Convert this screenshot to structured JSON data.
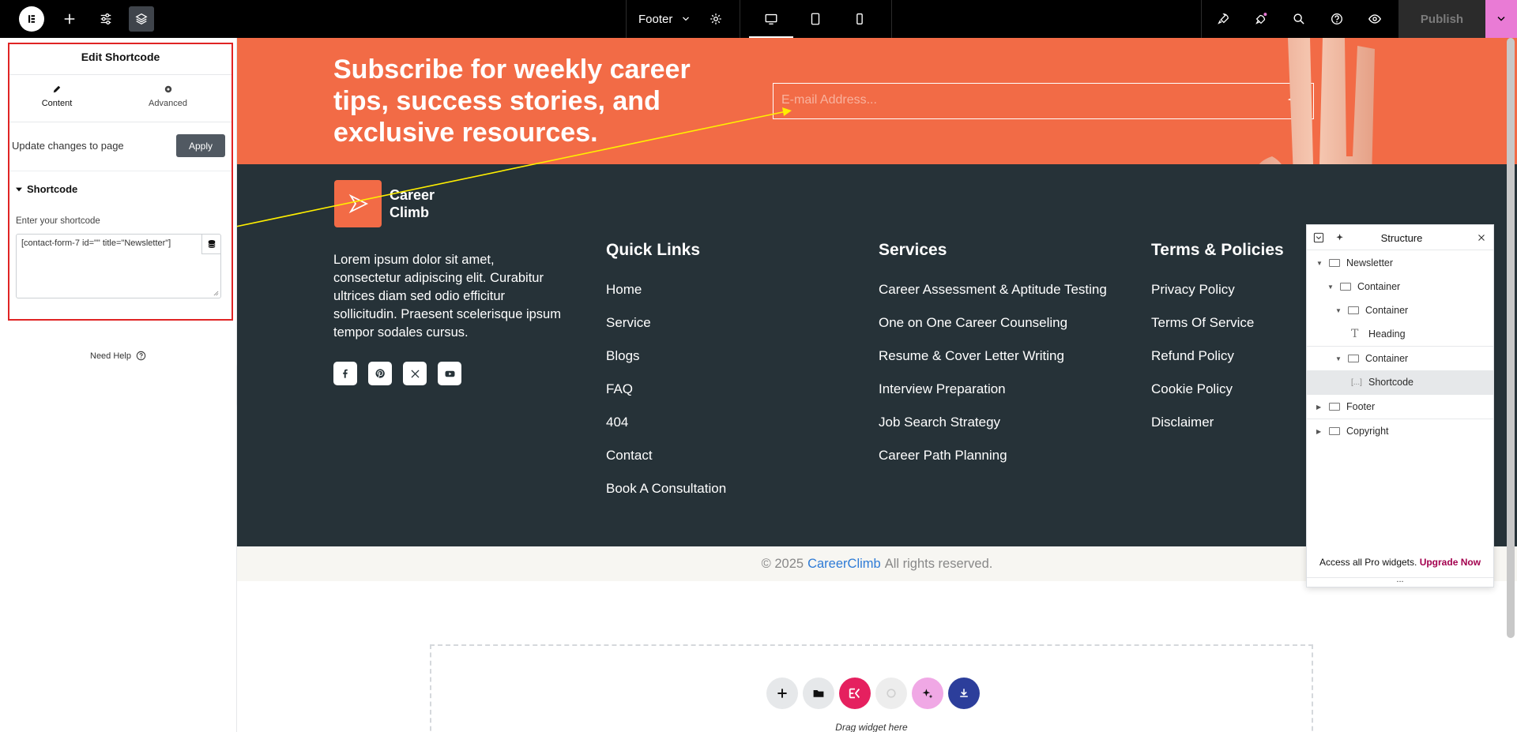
{
  "topbar": {
    "document_name": "Footer",
    "publish_label": "Publish",
    "icons": [
      "elementor-logo-icon",
      "add-icon",
      "sliders-icon",
      "layers-icon",
      "chevron-down-icon",
      "gear-icon",
      "desktop-icon",
      "tablet-icon",
      "mobile-icon",
      "rocket-icon",
      "sparkle-icon",
      "search-icon",
      "help-icon",
      "eye-icon"
    ]
  },
  "panel": {
    "title": "Edit Shortcode",
    "tabs": [
      {
        "label": "Content",
        "icon": "pencil-icon"
      },
      {
        "label": "Advanced",
        "icon": "gear-icon"
      }
    ],
    "update_text": "Update changes to page",
    "apply_label": "Apply",
    "section_title": "Shortcode",
    "field_label": "Enter your shortcode",
    "shortcode_value": "[contact-form-7 id=\"\" title=\"Newsletter\"]",
    "need_help": "Need Help"
  },
  "newsletter": {
    "heading_lines": [
      "Subscribe for weekly career",
      "tips, success stories, and",
      "exclusive resources."
    ],
    "email_placeholder": "E-mail Address...",
    "accent_color": "#f26b46"
  },
  "footer": {
    "brand_line1": "Career",
    "brand_line2": "Climb",
    "description_lines": [
      "Lorem ipsum dolor sit amet,",
      "consectetur adipiscing elit. Curabitur",
      "ultrices diam sed odio efficitur",
      "sollicitudin. Praesent scelerisque ipsum",
      "tempor sodales cursus."
    ],
    "social_icons": [
      "facebook-icon",
      "pinterest-icon",
      "x-icon",
      "youtube-icon"
    ],
    "quick_links_title": "Quick Links",
    "quick_links": [
      "Home",
      "Service",
      "Blogs",
      "FAQ",
      "404",
      "Contact",
      "Book A Consultation"
    ],
    "services_title": "Services",
    "services": [
      "Career Assessment & Aptitude Testing",
      "One on One Career Counseling",
      "Resume & Cover Letter Writing",
      "Interview Preparation",
      "Job Search Strategy",
      "Career Path Planning"
    ],
    "terms_title": "Terms & Policies",
    "terms": [
      "Privacy Policy",
      "Terms Of Service",
      "Refund Policy",
      "Cookie Policy",
      "Disclaimer"
    ],
    "bg_color": "#263238"
  },
  "copyright": {
    "prefix": "© 2025",
    "brand": "CareerClimb",
    "suffix": "All rights reserved."
  },
  "dropzone": {
    "label": "Drag widget here"
  },
  "structure": {
    "title": "Structure",
    "items": [
      {
        "label": "Newsletter"
      },
      {
        "label": "Container"
      },
      {
        "label": "Container"
      },
      {
        "label": "Heading"
      },
      {
        "label": "Container"
      },
      {
        "label": "Shortcode"
      },
      {
        "label": "Footer"
      },
      {
        "label": "Copyright"
      }
    ],
    "promo_text": "Access all Pro widgets.",
    "promo_link": "Upgrade Now",
    "more": "..."
  }
}
